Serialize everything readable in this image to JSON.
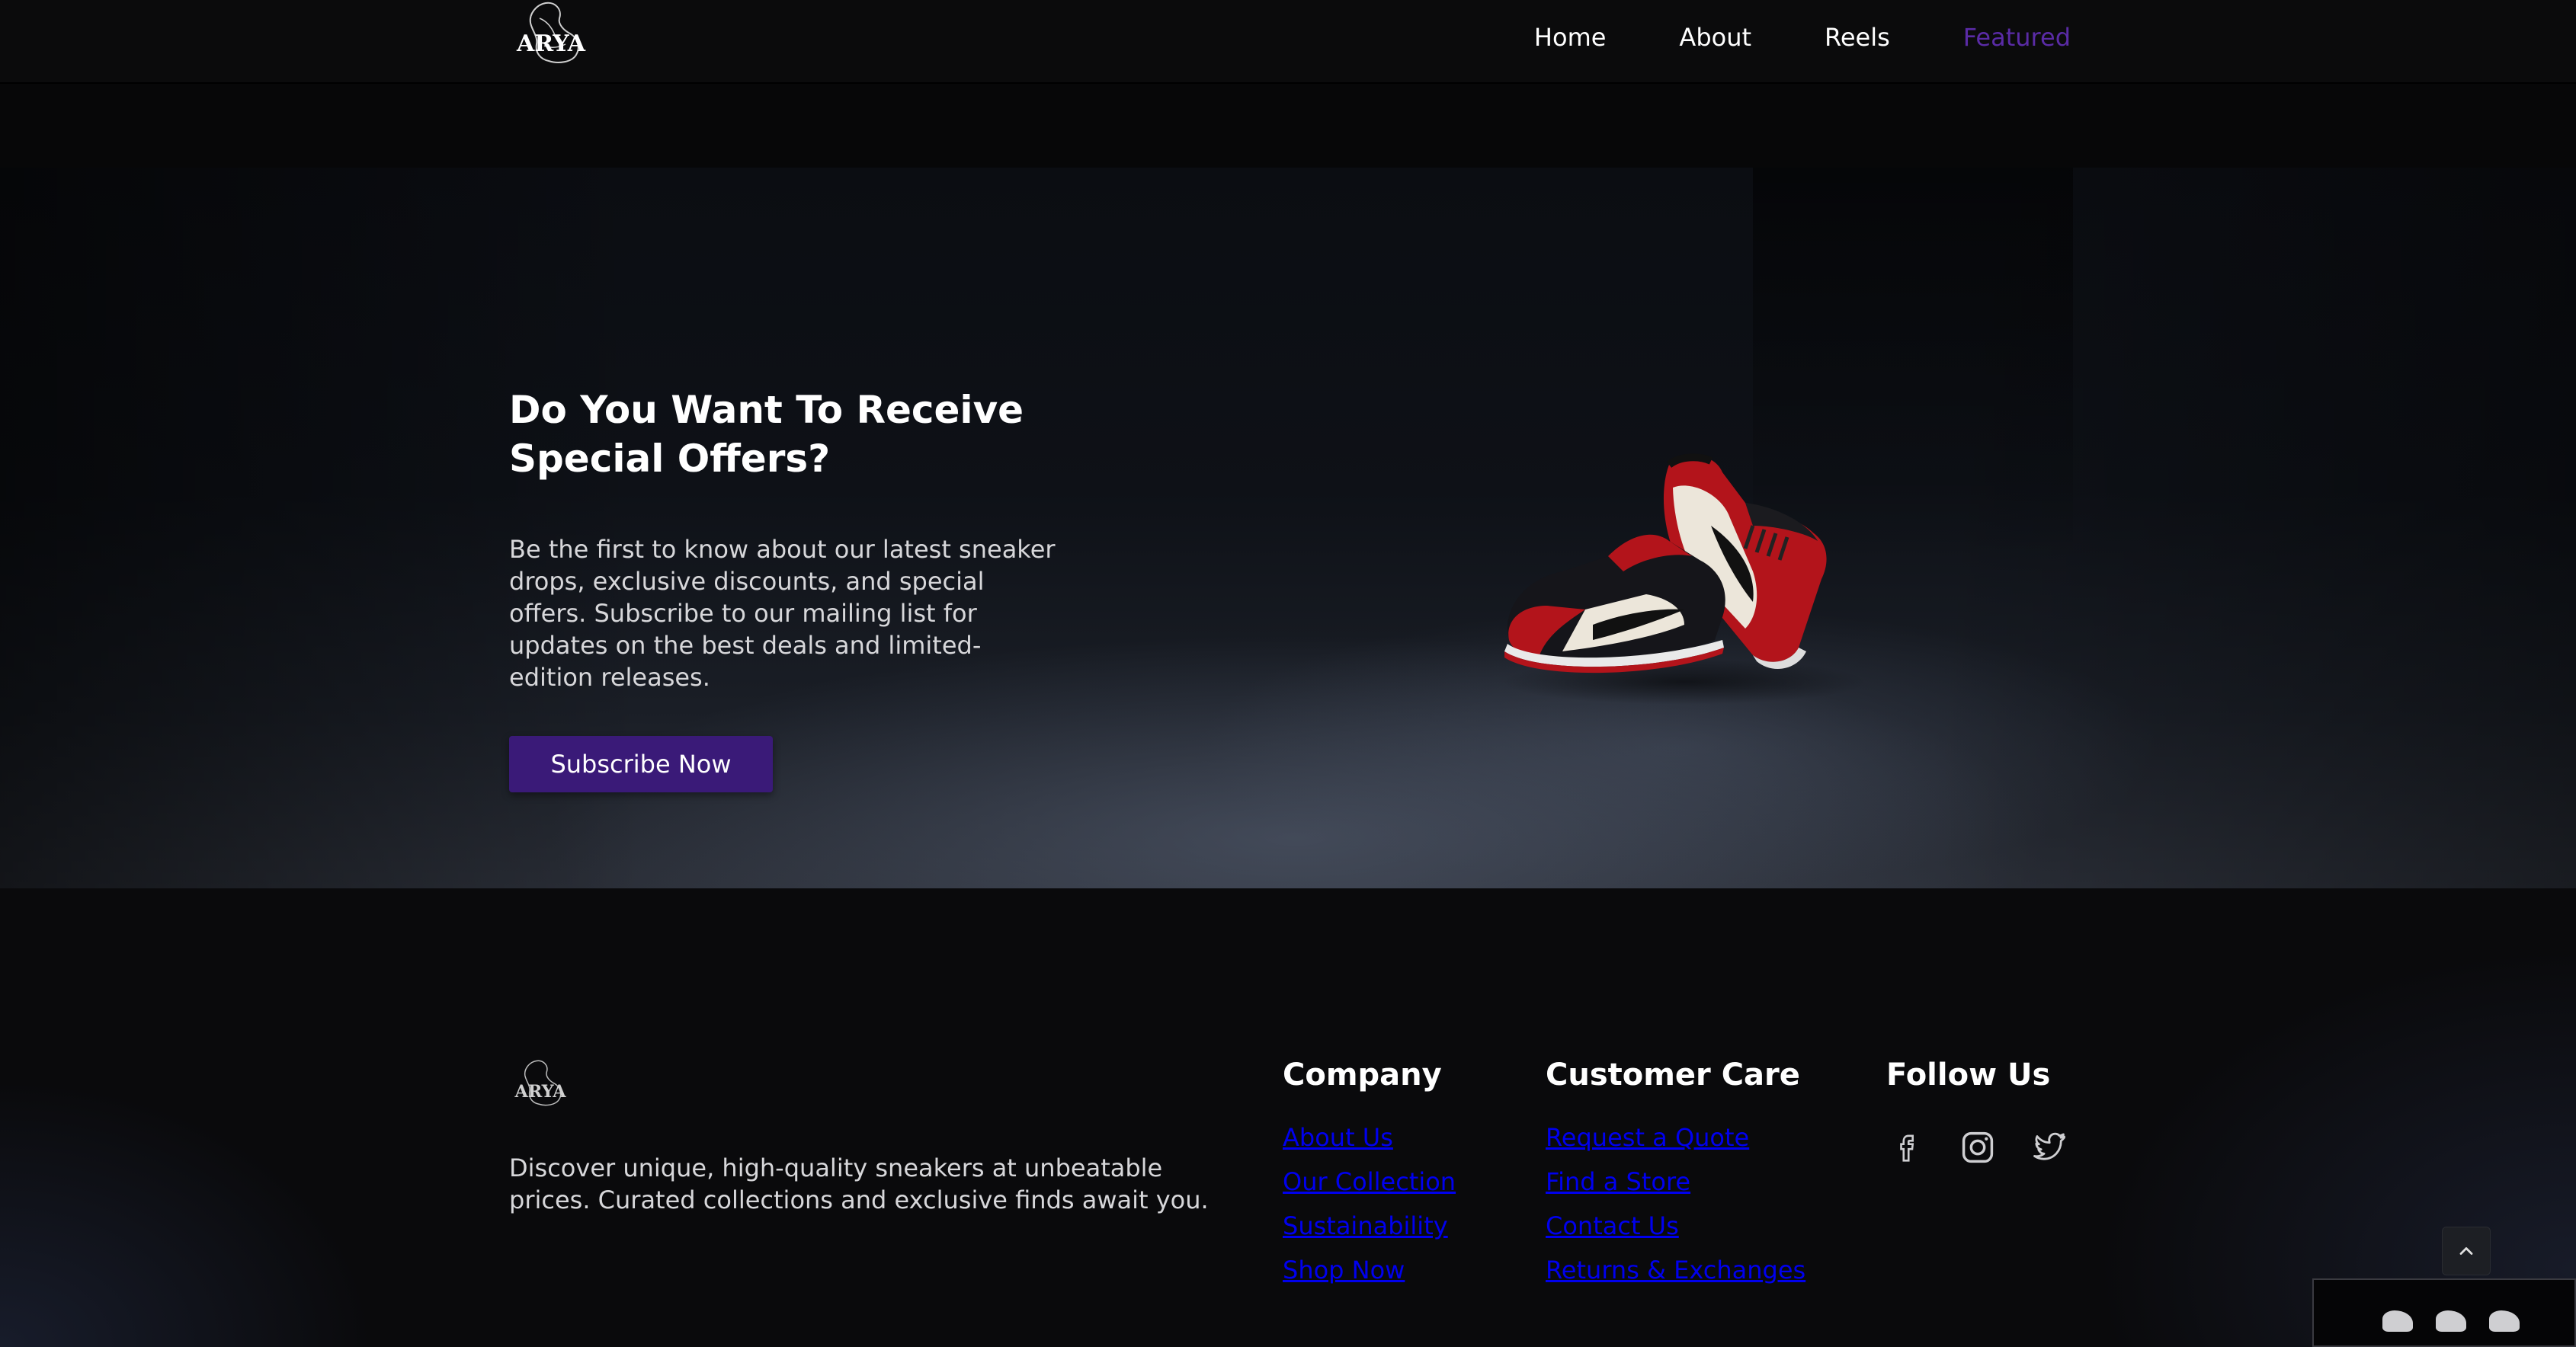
{
  "nav": {
    "logo_text": "ARYA",
    "links": [
      "Home",
      "About",
      "Reels",
      "Featured"
    ],
    "active": "Featured",
    "accent_color": "#5a2ba6"
  },
  "hero": {
    "title": "Do You Want To Receive Special Offers?",
    "description": "Be the first to know about our latest sneaker drops, exclusive discounts, and special offers. Subscribe to our mailing list for updates on the best deals and limited-edition releases.",
    "cta_label": "Subscribe Now",
    "cta_color": "#3a1a78",
    "image": "red-black-white-sneakers"
  },
  "footer": {
    "logo_text": "ARYA",
    "description": "Discover unique, high-quality sneakers at unbeatable prices. Curated collections and exclusive finds await you.",
    "company": {
      "heading": "Company",
      "links": [
        "About Us",
        "Our Collection",
        "Sustainability",
        "Shop Now"
      ]
    },
    "customer_care": {
      "heading": "Customer Care",
      "links": [
        "Request a Quote",
        "Find a Store",
        "Contact Us",
        "Returns & Exchanges"
      ]
    },
    "follow": {
      "heading": "Follow Us",
      "icons": [
        "facebook-icon",
        "instagram-icon",
        "twitter-icon"
      ]
    },
    "link_color": "#0000ee"
  },
  "back_to_top_icon": "chevron-up-icon"
}
